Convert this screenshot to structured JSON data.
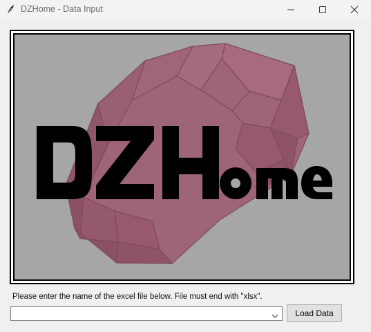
{
  "window": {
    "title": "DZHome - Data Input",
    "icon": "feather-icon",
    "controls": [
      "minimize-icon",
      "maximize-icon",
      "close-icon"
    ]
  },
  "logo": {
    "text_left": "DZH",
    "text_right": "ome",
    "gem_color": "#9e6478",
    "background": "#a6a6a6"
  },
  "form": {
    "prompt": "Please enter the name of the excel file below. File must end with \"xlsx\".",
    "file_input_value": "",
    "load_button_label": "Load Data"
  }
}
